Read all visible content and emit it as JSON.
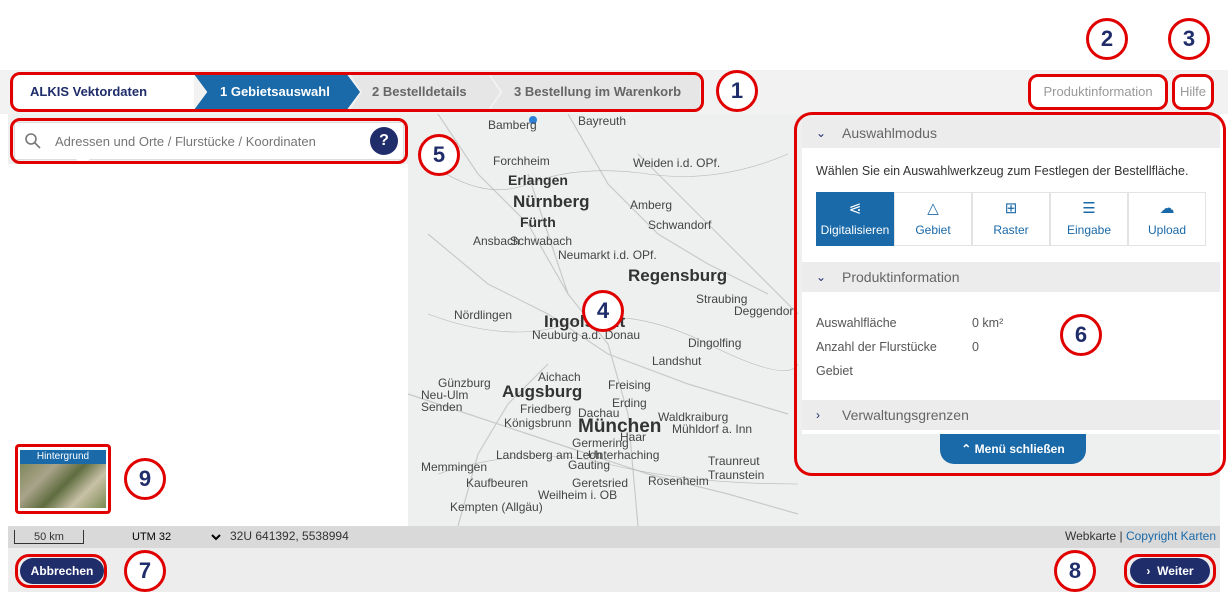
{
  "nav": {
    "product_name": "ALKIS Vektordaten",
    "steps": [
      {
        "label": "1 Gebietsauswahl",
        "active": true
      },
      {
        "label": "2 Bestelldetails",
        "active": false
      },
      {
        "label": "3 Bestellung im Warenkorb",
        "active": false
      }
    ],
    "product_info_link": "Produktinformation",
    "help_link": "Hilfe"
  },
  "search": {
    "placeholder": "Adressen und Orte / Flurstücke / Koordinaten",
    "help_symbol": "?"
  },
  "map": {
    "cities": [
      "Bamberg",
      "Bayreuth",
      "Forchheim",
      "Weiden i.d. OPf.",
      "Erlangen",
      "Nürnberg",
      "Amberg",
      "Fürth",
      "Schwandorf",
      "Ansbach",
      "Schwabach",
      "Neumarkt i.d. OPf.",
      "Regensburg",
      "Straubing",
      "Deggendorf",
      "Nördlingen",
      "Ingolstadt",
      "Neuburg a.d. Donau",
      "Dingolfing",
      "Landshut",
      "Aichach",
      "Günzburg",
      "Augsburg",
      "Freising",
      "Neu-Ulm",
      "Senden",
      "Friedberg",
      "Erding",
      "Dachau",
      "Waldkraiburg",
      "Königsbrunn",
      "München",
      "Mühldorf a. Inn",
      "Germering",
      "Haar",
      "Memmingen",
      "Landsberg am Lech",
      "Unterhaching",
      "Gauting",
      "Traunreut",
      "Kaufbeuren",
      "Geretsried",
      "Rosenheim",
      "Traunstein",
      "Weilheim i. OB",
      "Kempten (Allgäu)"
    ]
  },
  "panel": {
    "section_selection": "Auswahlmodus",
    "intro": "Wählen Sie ein Auswahlwerkzeug zum Festlegen der Bestellfläche.",
    "tools": [
      {
        "label": "Digitalisieren",
        "icon": "share-icon",
        "active": true
      },
      {
        "label": "Gebiet",
        "icon": "triangle-icon",
        "active": false
      },
      {
        "label": "Raster",
        "icon": "grid-icon",
        "active": false
      },
      {
        "label": "Eingabe",
        "icon": "list-icon",
        "active": false
      },
      {
        "label": "Upload",
        "icon": "cloud-upload-icon",
        "active": false
      }
    ],
    "section_product": "Produktinformation",
    "info": {
      "area_label": "Auswahlfläche",
      "area_value": "0 km²",
      "parcel_count_label": "Anzahl der Flurstücke",
      "parcel_count_value": "0",
      "region_label": "Gebiet"
    },
    "section_admin": "Verwaltungsgrenzen",
    "close_menu": "Menü schließen"
  },
  "background_switch": {
    "label": "Hintergrund"
  },
  "status_bar": {
    "scale": "50 km",
    "crs_selected": "UTM 32",
    "coordinates": "32U 641392, 5538994",
    "basemap": "Webkarte",
    "separator": "|",
    "copyright_link": "Copyright Karten"
  },
  "footer": {
    "cancel": "Abbrechen",
    "next": "Weiter"
  },
  "annotations": [
    "1",
    "2",
    "3",
    "4",
    "5",
    "6",
    "7",
    "8",
    "9"
  ],
  "colors": {
    "primary": "#1a69a8",
    "dark_navy": "#1f2d6b",
    "annotation_red": "#e00000"
  }
}
